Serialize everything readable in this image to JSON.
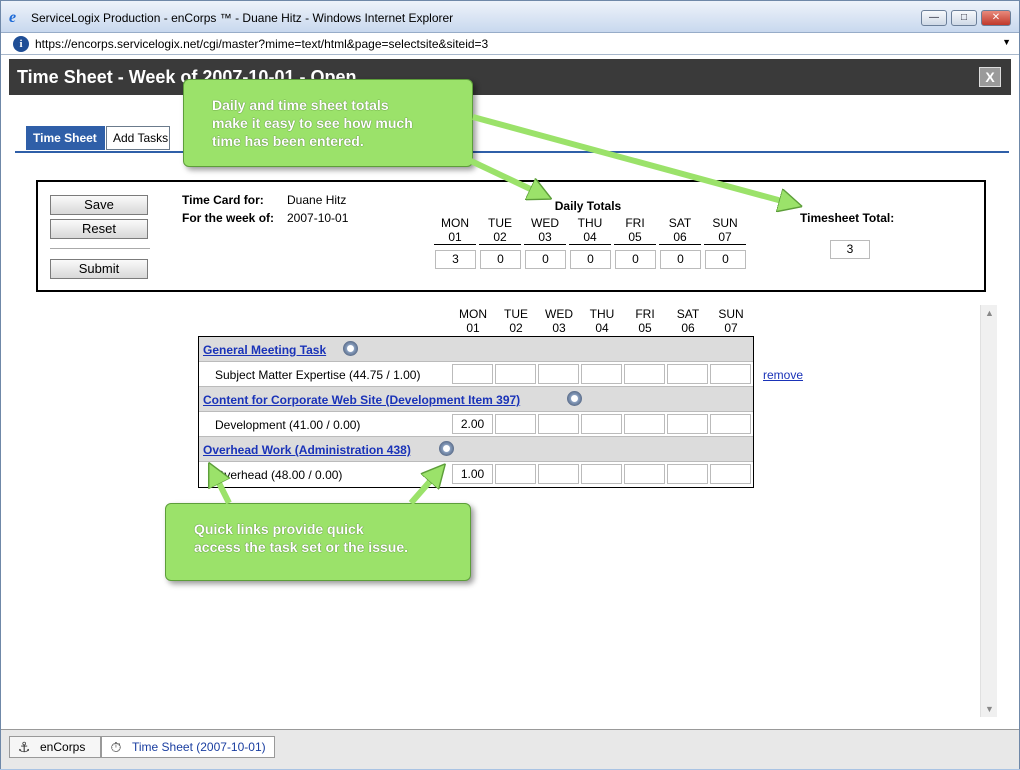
{
  "browser": {
    "title": "ServiceLogix Production - enCorps ™ - Duane Hitz - Windows Internet Explorer",
    "url": "https://encorps.servicelogix.net/cgi/master?mime=text/html&page=selectsite&siteid=3",
    "ie_icon": "e",
    "info_icon": "i",
    "minimize": "—",
    "maximize": "□",
    "close": "✕",
    "dropdown": "▼"
  },
  "header": {
    "title": "Time Sheet - Week of 2007-10-01 - Open",
    "close": "X"
  },
  "tabs": [
    {
      "label": "Time Sheet"
    },
    {
      "label": "Add Tasks"
    }
  ],
  "card": {
    "save": "Save",
    "reset": "Reset",
    "submit": "Submit",
    "time_card_label": "Time Card for:",
    "time_card_value": "Duane Hitz",
    "week_label": "For the week of:",
    "week_value": "2007-10-01",
    "daily_title": "Daily Totals",
    "days": [
      {
        "name": "MON",
        "date": "01",
        "total": "3"
      },
      {
        "name": "TUE",
        "date": "02",
        "total": "0"
      },
      {
        "name": "WED",
        "date": "03",
        "total": "0"
      },
      {
        "name": "THU",
        "date": "04",
        "total": "0"
      },
      {
        "name": "FRI",
        "date": "05",
        "total": "0"
      },
      {
        "name": "SAT",
        "date": "06",
        "total": "0"
      },
      {
        "name": "SUN",
        "date": "07",
        "total": "0"
      }
    ],
    "timesheet_total_label": "Timesheet Total:",
    "timesheet_total": "3"
  },
  "grid": {
    "remove": "remove",
    "task_groups": [
      {
        "title": "General Meeting Task",
        "row": {
          "name": "Subject Matter Expertise (44.75 / 1.00)",
          "hours": [
            "",
            "",
            "",
            "",
            "",
            "",
            ""
          ]
        }
      },
      {
        "title": "Content for Corporate Web Site (Development Item 397)",
        "row": {
          "name": "Development (41.00 / 0.00)",
          "hours": [
            "2.00",
            "",
            "",
            "",
            "",
            "",
            ""
          ]
        }
      },
      {
        "title": "Overhead Work (Administration 438)",
        "row": {
          "name": "Overhead (48.00 / 0.00)",
          "hours": [
            "1.00",
            "",
            "",
            "",
            "",
            "",
            ""
          ]
        }
      }
    ]
  },
  "taskbar": [
    {
      "label": "enCorps",
      "icon": "⚓"
    },
    {
      "label": "Time Sheet (2007-10-01)",
      "icon": "⏱"
    }
  ],
  "scrollbar": {
    "up": "▲",
    "down": "▼"
  },
  "callouts": {
    "top": [
      "Daily and time sheet totals",
      "make it easy to see how much",
      "time has been entered."
    ],
    "bottom": [
      "Quick links provide quick",
      "access the task set or the issue."
    ]
  },
  "colors": {
    "accent": "#2f5fa8",
    "header_bg": "#3a3a3a",
    "callout": "#9be26a",
    "link": "#1a33b8"
  }
}
